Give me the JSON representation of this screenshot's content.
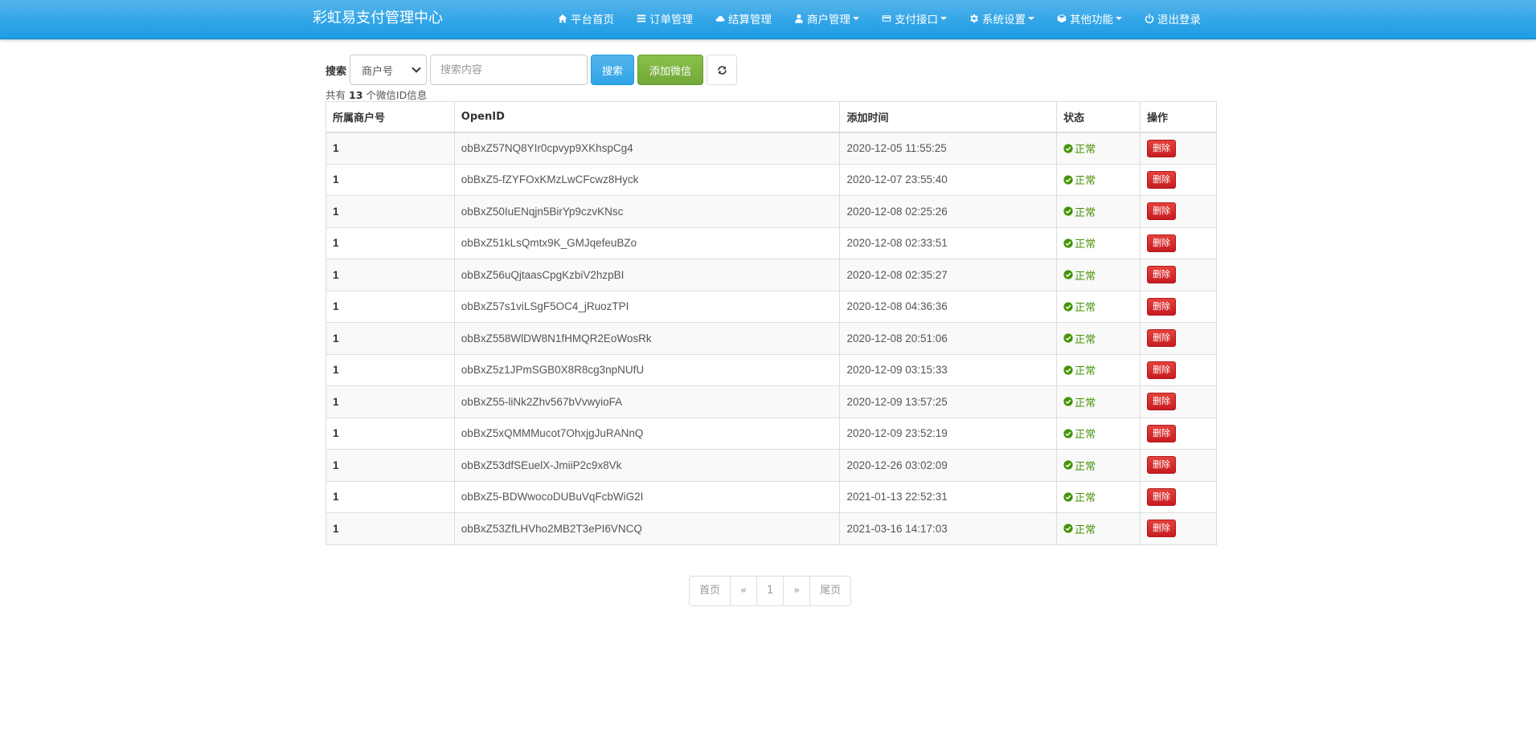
{
  "nav": {
    "brand": "彩虹易支付管理中心",
    "items": [
      {
        "label": "平台首页",
        "icon": "home-icon",
        "dropdown": false
      },
      {
        "label": "订单管理",
        "icon": "list-icon",
        "dropdown": false
      },
      {
        "label": "结算管理",
        "icon": "cloud-icon",
        "dropdown": false
      },
      {
        "label": "商户管理",
        "icon": "user-icon",
        "dropdown": true
      },
      {
        "label": "支付接口",
        "icon": "credit-card-icon",
        "dropdown": true
      },
      {
        "label": "系统设置",
        "icon": "gear-icon",
        "dropdown": true
      },
      {
        "label": "其他功能",
        "icon": "cube-icon",
        "dropdown": true
      },
      {
        "label": "退出登录",
        "icon": "power-icon",
        "dropdown": false
      }
    ]
  },
  "search": {
    "label": "搜索",
    "select_value": "商户号",
    "placeholder": "搜索内容",
    "value": "",
    "search_button": "搜索",
    "add_button": "添加微信",
    "refresh_icon": "refresh-icon"
  },
  "summary": {
    "prefix": "共有",
    "count": "13",
    "suffix": "个微信ID信息"
  },
  "table": {
    "headers": [
      "所属商户号",
      "OpenID",
      "添加时间",
      "状态",
      "操作"
    ],
    "rows": [
      {
        "uid": "1",
        "openid": "obBxZ57NQ8YIr0cpvyp9XKhspCg4",
        "time": "2020-12-05 11:55:25",
        "status": "正常",
        "action": "删除"
      },
      {
        "uid": "1",
        "openid": "obBxZ5-fZYFOxKMzLwCFcwz8Hyck",
        "time": "2020-12-07 23:55:40",
        "status": "正常",
        "action": "删除"
      },
      {
        "uid": "1",
        "openid": "obBxZ50IuENqjn5BirYp9czvKNsc",
        "time": "2020-12-08 02:25:26",
        "status": "正常",
        "action": "删除"
      },
      {
        "uid": "1",
        "openid": "obBxZ51kLsQmtx9K_GMJqefeuBZo",
        "time": "2020-12-08 02:33:51",
        "status": "正常",
        "action": "删除"
      },
      {
        "uid": "1",
        "openid": "obBxZ56uQjtaasCpgKzbiV2hzpBI",
        "time": "2020-12-08 02:35:27",
        "status": "正常",
        "action": "删除"
      },
      {
        "uid": "1",
        "openid": "obBxZ57s1viLSgF5OC4_jRuozTPI",
        "time": "2020-12-08 04:36:36",
        "status": "正常",
        "action": "删除"
      },
      {
        "uid": "1",
        "openid": "obBxZ558WlDW8N1fHMQR2EoWosRk",
        "time": "2020-12-08 20:51:06",
        "status": "正常",
        "action": "删除"
      },
      {
        "uid": "1",
        "openid": "obBxZ5z1JPmSGB0X8R8cg3npNUfU",
        "time": "2020-12-09 03:15:33",
        "status": "正常",
        "action": "删除"
      },
      {
        "uid": "1",
        "openid": "obBxZ55-liNk2Zhv567bVvwyioFA",
        "time": "2020-12-09 13:57:25",
        "status": "正常",
        "action": "删除"
      },
      {
        "uid": "1",
        "openid": "obBxZ5xQMMMucot7OhxjgJuRANnQ",
        "time": "2020-12-09 23:52:19",
        "status": "正常",
        "action": "删除"
      },
      {
        "uid": "1",
        "openid": "obBxZ53dfSEuelX-JmiiP2c9x8Vk",
        "time": "2020-12-26 03:02:09",
        "status": "正常",
        "action": "删除"
      },
      {
        "uid": "1",
        "openid": "obBxZ5-BDWwocoDUBuVqFcbWiG2I",
        "time": "2021-01-13 22:52:31",
        "status": "正常",
        "action": "删除"
      },
      {
        "uid": "1",
        "openid": "obBxZ53ZfLHVho2MB2T3ePI6VNCQ",
        "time": "2021-03-16 14:17:03",
        "status": "正常",
        "action": "删除"
      }
    ]
  },
  "pagination": {
    "first": "首页",
    "prev": "«",
    "current": "1",
    "next": "»",
    "last": "尾页"
  },
  "colors": {
    "navbar": "#2fa4e7",
    "primary": "#2fa4e7",
    "success": "#73a839",
    "danger": "#c71c22",
    "status_ok": "#469408"
  }
}
